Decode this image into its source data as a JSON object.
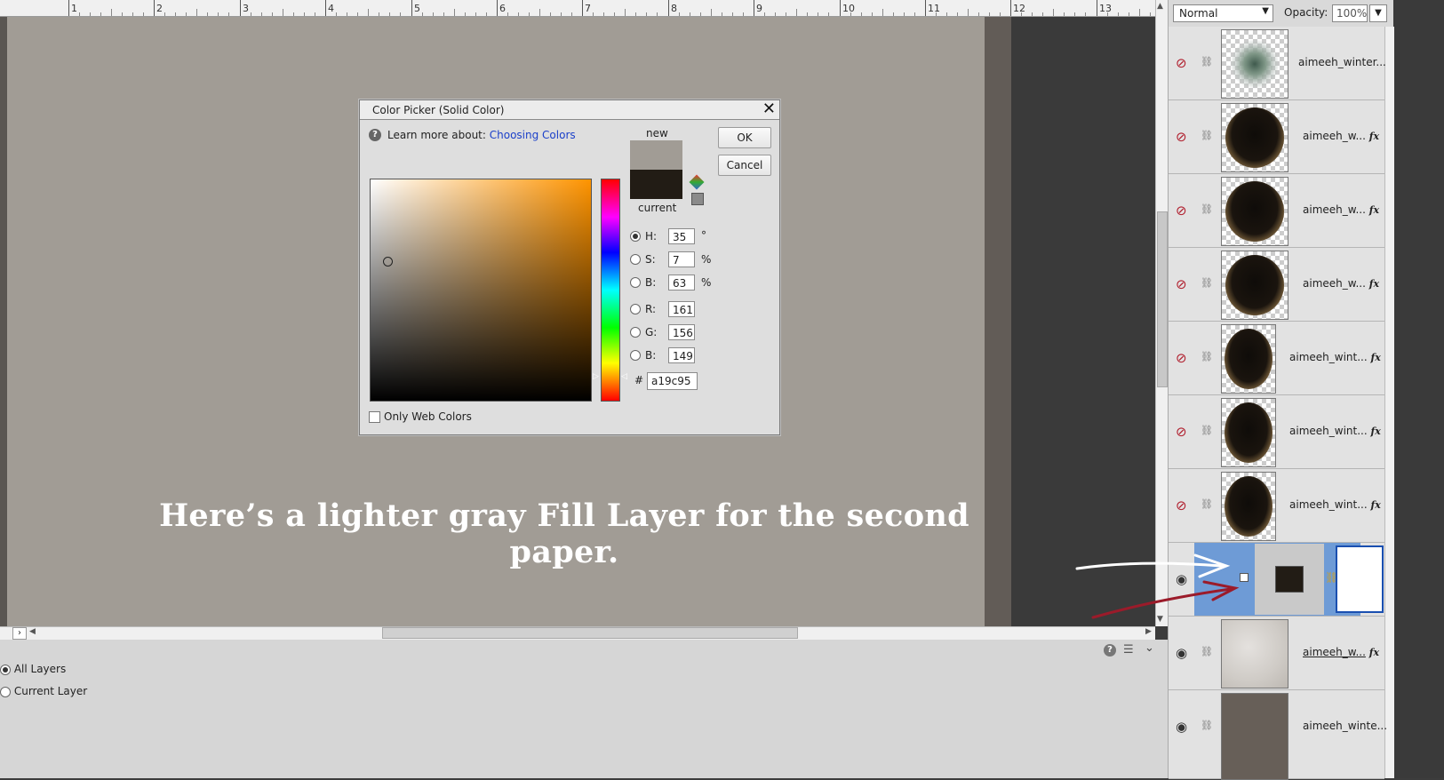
{
  "ruler": {
    "numbers": [
      "1",
      "2",
      "3",
      "4",
      "5",
      "6",
      "7",
      "8",
      "9",
      "10",
      "11",
      "12",
      "13"
    ]
  },
  "annotation": {
    "caption": "Here’s a lighter gray Fill Layer for the second paper."
  },
  "dialog": {
    "title": "Color Picker (Solid Color)",
    "learn_more_label": "Learn more about:",
    "learn_more_link": "Choosing Colors",
    "new_label": "new",
    "current_label": "current",
    "ok_label": "OK",
    "cancel_label": "Cancel",
    "only_web_colors_label": "Only Web Colors",
    "fields": [
      {
        "label": "H:",
        "value": "35",
        "unit": "°",
        "selected": true
      },
      {
        "label": "S:",
        "value": "7",
        "unit": "%",
        "selected": false
      },
      {
        "label": "B:",
        "value": "63",
        "unit": "%",
        "selected": false
      },
      {
        "label": "R:",
        "value": "161",
        "unit": "",
        "selected": false
      },
      {
        "label": "G:",
        "value": "156",
        "unit": "",
        "selected": false
      },
      {
        "label": "B:",
        "value": "149",
        "unit": "",
        "selected": false
      }
    ],
    "hex_label": "#",
    "hex_value": "a19c95",
    "new_color": "#a19c95",
    "current_color": "#221c15",
    "hue_color": "#ff9400"
  },
  "bottom_panel": {
    "options": [
      {
        "label": "All Layers",
        "selected": true
      },
      {
        "label": "Current Layer",
        "selected": false
      }
    ]
  },
  "layers_panel": {
    "blend_mode": "Normal",
    "opacity_label": "Opacity:",
    "opacity_value": "100%",
    "layers": [
      {
        "name": "aimeeh_winter...",
        "fx": "",
        "visible": false,
        "thumb": "sparkle"
      },
      {
        "name": "aimeeh_w...",
        "fx": "fx",
        "visible": false,
        "thumb": "ring"
      },
      {
        "name": "aimeeh_w...",
        "fx": "fx",
        "visible": false,
        "thumb": "ring"
      },
      {
        "name": "aimeeh_w...",
        "fx": "fx",
        "visible": false,
        "thumb": "ring"
      },
      {
        "name": "aimeeh_wint...",
        "fx": "fx",
        "visible": false,
        "thumb": "ring-narrow"
      },
      {
        "name": "aimeeh_wint...",
        "fx": "fx",
        "visible": false,
        "thumb": "ring-narrow"
      },
      {
        "name": "aimeeh_wint...",
        "fx": "fx",
        "visible": false,
        "thumb": "ring-narrow"
      },
      {
        "name": "",
        "fx": "",
        "visible": true,
        "thumb": "fill"
      },
      {
        "name": "aimeeh_w...",
        "fx": "fx",
        "visible": true,
        "thumb": "paper"
      },
      {
        "name": "aimeeh_winte...",
        "fx": "",
        "visible": true,
        "thumb": "dark"
      }
    ]
  }
}
